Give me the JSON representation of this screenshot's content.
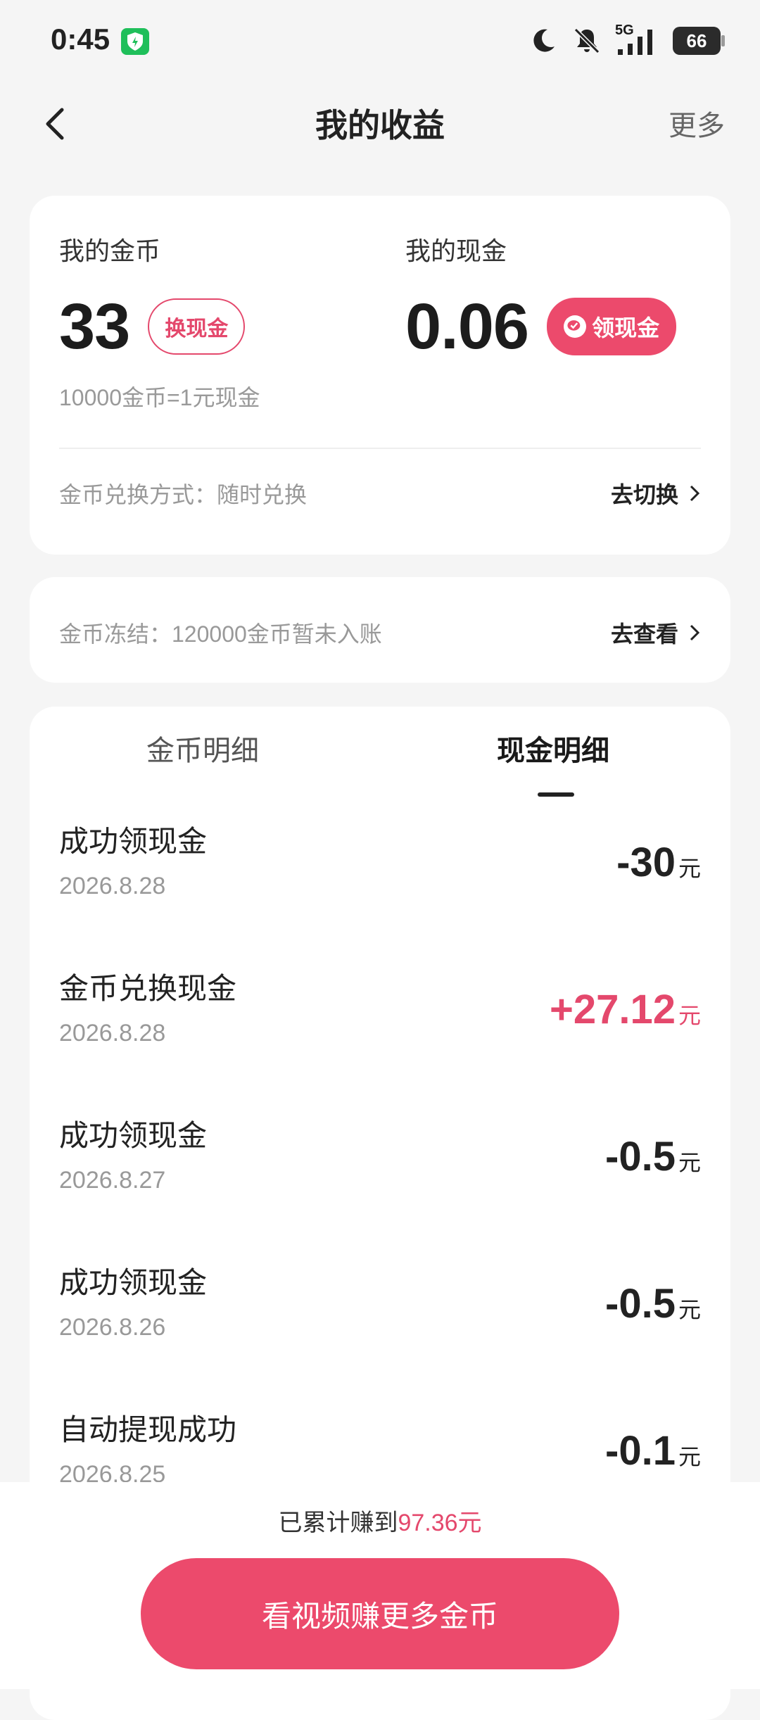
{
  "status_bar": {
    "time": "0:45",
    "network": "5G",
    "battery": "66"
  },
  "header": {
    "title": "我的收益",
    "more": "更多"
  },
  "balance": {
    "coin_label": "我的金币",
    "coin_value": "33",
    "exchange_btn": "换现金",
    "cash_label": "我的现金",
    "cash_value": "0.06",
    "claim_btn": "领现金",
    "rate": "10000金币=1元现金",
    "method": "金币兑换方式：随时兑换",
    "switch_link": "去切换"
  },
  "frozen": {
    "text": "金币冻结：120000金币暂未入账",
    "view_link": "去查看"
  },
  "tabs": {
    "coin_detail": "金币明细",
    "cash_detail": "现金明细",
    "active": "cash_detail"
  },
  "transactions": [
    {
      "title": "成功领现金",
      "date": "2026.8.28",
      "amount": "-30",
      "unit": "元"
    },
    {
      "title": "金币兑换现金",
      "date": "2026.8.28",
      "amount": "+27.12",
      "unit": "元"
    },
    {
      "title": "成功领现金",
      "date": "2026.8.27",
      "amount": "-0.5",
      "unit": "元"
    },
    {
      "title": "成功领现金",
      "date": "2026.8.26",
      "amount": "-0.5",
      "unit": "元"
    },
    {
      "title": "自动提现成功",
      "date": "2026.8.25",
      "amount": "-0.1",
      "unit": "元"
    }
  ],
  "footer": {
    "total_prefix": "已累计赚到",
    "total_value": "97.36元",
    "cta": "看视频赚更多金币"
  },
  "colors": {
    "accent": "#ec4a6c",
    "background": "#f5f5f5"
  }
}
